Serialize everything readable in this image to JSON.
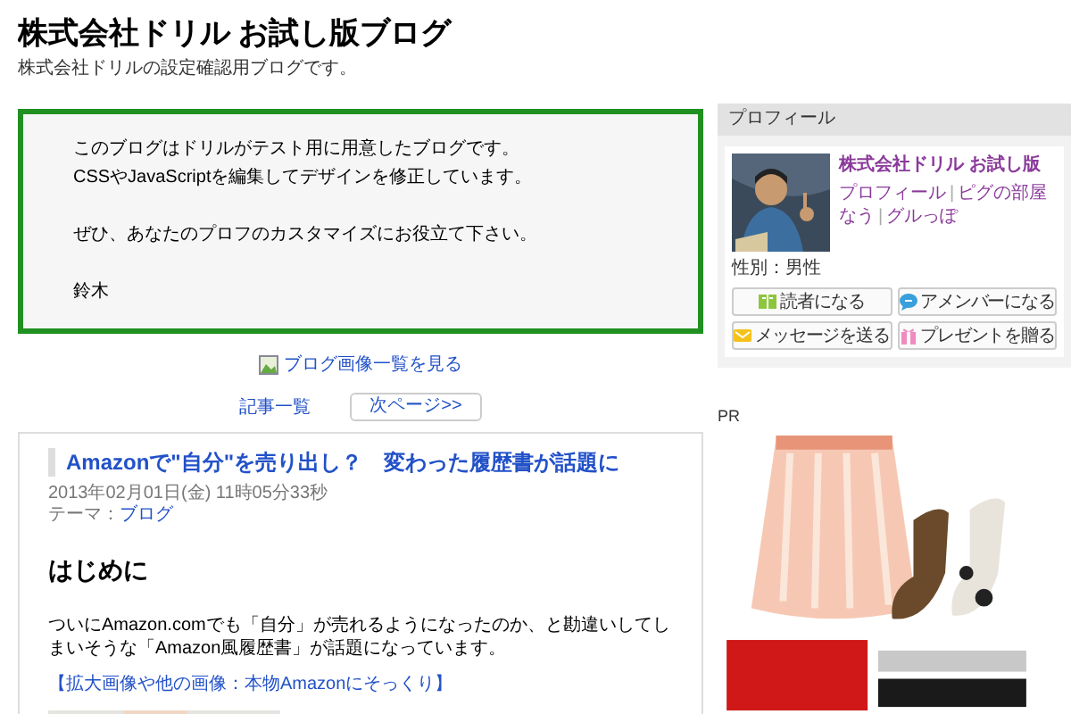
{
  "header": {
    "title": "株式会社ドリル お試し版ブログ",
    "description": "株式会社ドリルの設定確認用ブログです。"
  },
  "notice": {
    "paragraphs": [
      [
        "このブログはドリルがテスト用に用意したブログです。",
        "CSSやJavaScriptを編集してデザインを修正しています。"
      ],
      [
        "ぜひ、あなたのプロフのカスタマイズにお役立て下さい。"
      ],
      [
        "鈴木"
      ]
    ]
  },
  "image_list_link": "ブログ画像一覧を見る",
  "pager": {
    "list": "記事一覧",
    "next": "次ページ>>"
  },
  "article": {
    "title": "Amazonで\"自分\"を売り出し？　変わった履歴書が話題に",
    "date": "2013年02月01日(金) 11時05分33秒",
    "theme_label": "テーマ：",
    "theme": "ブログ",
    "heading": "はじめに",
    "body": "ついにAmazon.comでも「自分」が売れるようになったのか、と勘違いしてしまいそうな「Amazon風履歴書」が話題になっています。",
    "link": "【拡大画像や他の画像：本物Amazonにそっくり】"
  },
  "profile": {
    "heading": "プロフィール",
    "name": "株式会社ドリル お試し版",
    "separator": "|",
    "link_lines": [
      [
        "プロフィール",
        "ピグの部屋"
      ],
      [
        "なう",
        "グルっぽ"
      ]
    ],
    "gender": "性別：男性",
    "buttons": [
      {
        "kind": "reader",
        "label": "読者になる"
      },
      {
        "kind": "amember",
        "label": "アメンバーになる"
      },
      {
        "kind": "message",
        "label": "メッセージを送る"
      },
      {
        "kind": "present",
        "label": "プレゼントを贈る"
      }
    ]
  },
  "pr": {
    "label": "PR"
  }
}
